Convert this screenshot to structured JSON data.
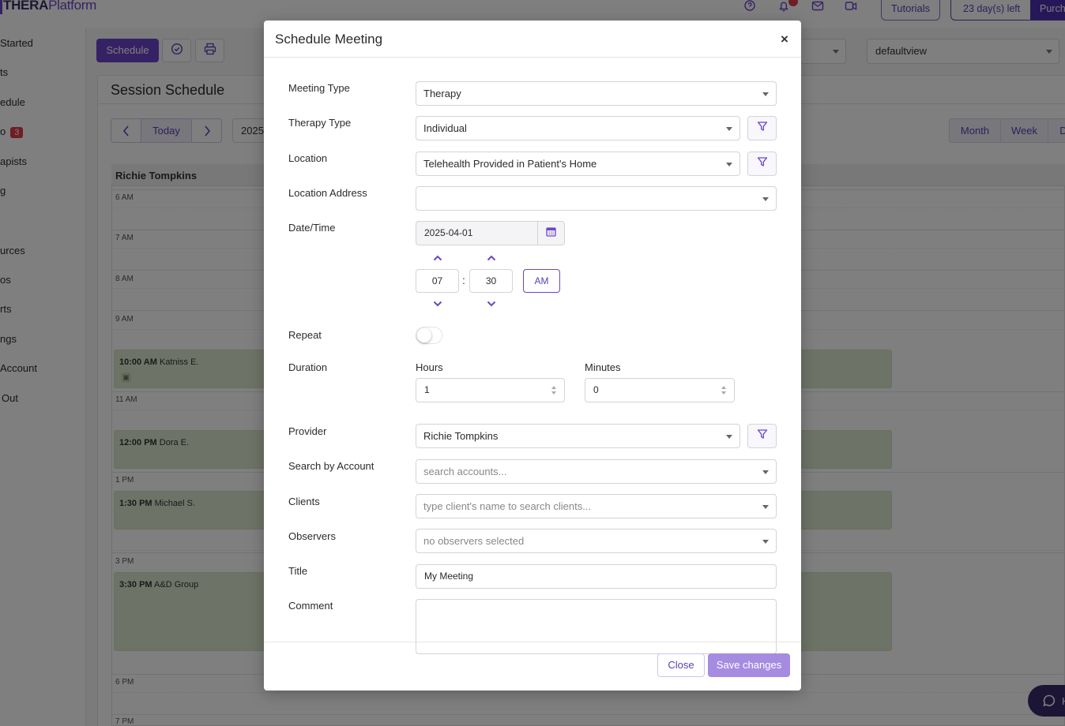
{
  "app": {
    "logo_bold": "THERA",
    "logo_light": "Platform",
    "tutorials_label": "Tutorials",
    "trial_text": "23 day(s) left",
    "purchase_label": "Purch"
  },
  "sidebar": {
    "items": [
      {
        "label": "Started"
      },
      {
        "label": "ts"
      },
      {
        "label": "edule"
      },
      {
        "label": "o",
        "badge": "3"
      },
      {
        "label": "apists"
      },
      {
        "label": "g"
      },
      {
        "label": "urces"
      },
      {
        "label": "os"
      },
      {
        "label": "rts"
      },
      {
        "label": "ngs"
      },
      {
        "label": "Account"
      },
      {
        "label": "Out"
      }
    ]
  },
  "toolbar": {
    "schedule_label": "Schedule",
    "view_select_value": "defaultview"
  },
  "schedule": {
    "title": "Session Schedule",
    "today_label": "Today",
    "date_partial": "2025-",
    "views": [
      "Month",
      "Week",
      "D"
    ],
    "provider_name": "Richie Tompkins",
    "hours": [
      "6 AM",
      "7 AM",
      "8 AM",
      "9 AM",
      "11 AM",
      "1 PM",
      "3 PM",
      "6 PM",
      "7 PM"
    ],
    "events": [
      {
        "time": "10:00 AM",
        "name": "Katniss E."
      },
      {
        "time": "12:00 PM",
        "name": "Dora E."
      },
      {
        "time": "1:30 PM",
        "name": "Michael S."
      },
      {
        "time": "3:30 PM",
        "name": "A&D Group"
      }
    ]
  },
  "modal": {
    "title": "Schedule Meeting",
    "close_x": "×",
    "labels": {
      "meeting_type": "Meeting Type",
      "therapy_type": "Therapy Type",
      "location": "Location",
      "location_address": "Location Address",
      "date_time": "Date/Time",
      "repeat": "Repeat",
      "duration": "Duration",
      "hours": "Hours",
      "minutes": "Minutes",
      "provider": "Provider",
      "search_account": "Search by Account",
      "clients": "Clients",
      "observers": "Observers",
      "title": "Title",
      "comment": "Comment"
    },
    "values": {
      "meeting_type": "Therapy",
      "therapy_type": "Individual",
      "location": "Telehealth Provided in Patient's Home",
      "location_address": "",
      "date": "2025-04-01",
      "hour": "07",
      "minute": "30",
      "colon": ":",
      "ampm": "AM",
      "repeat_on": false,
      "duration_hours": "1",
      "duration_minutes": "0",
      "provider": "Richie Tompkins",
      "title": "My Meeting",
      "comment": ""
    },
    "placeholders": {
      "search_account": "search accounts...",
      "clients": "type client's name to search clients...",
      "observers": "no observers selected"
    },
    "footer": {
      "close_label": "Close",
      "save_label": "Save changes"
    }
  },
  "help_fab": {
    "label": "H"
  },
  "colors": {
    "accent": "#6a45c9",
    "accent_dark": "#4c2fb0",
    "event_bg": "#dbe9cf",
    "badge_red": "#e03b4a",
    "save_disabled": "#a58ce0"
  },
  "icons": [
    "help-circle-icon",
    "bell-icon",
    "mail-icon",
    "video-icon",
    "check-circle-icon",
    "printer-icon",
    "chevron-left-icon",
    "chevron-right-icon",
    "filter-icon",
    "calendar-icon",
    "chevron-up-icon",
    "chevron-down-icon",
    "chat-icon"
  ]
}
